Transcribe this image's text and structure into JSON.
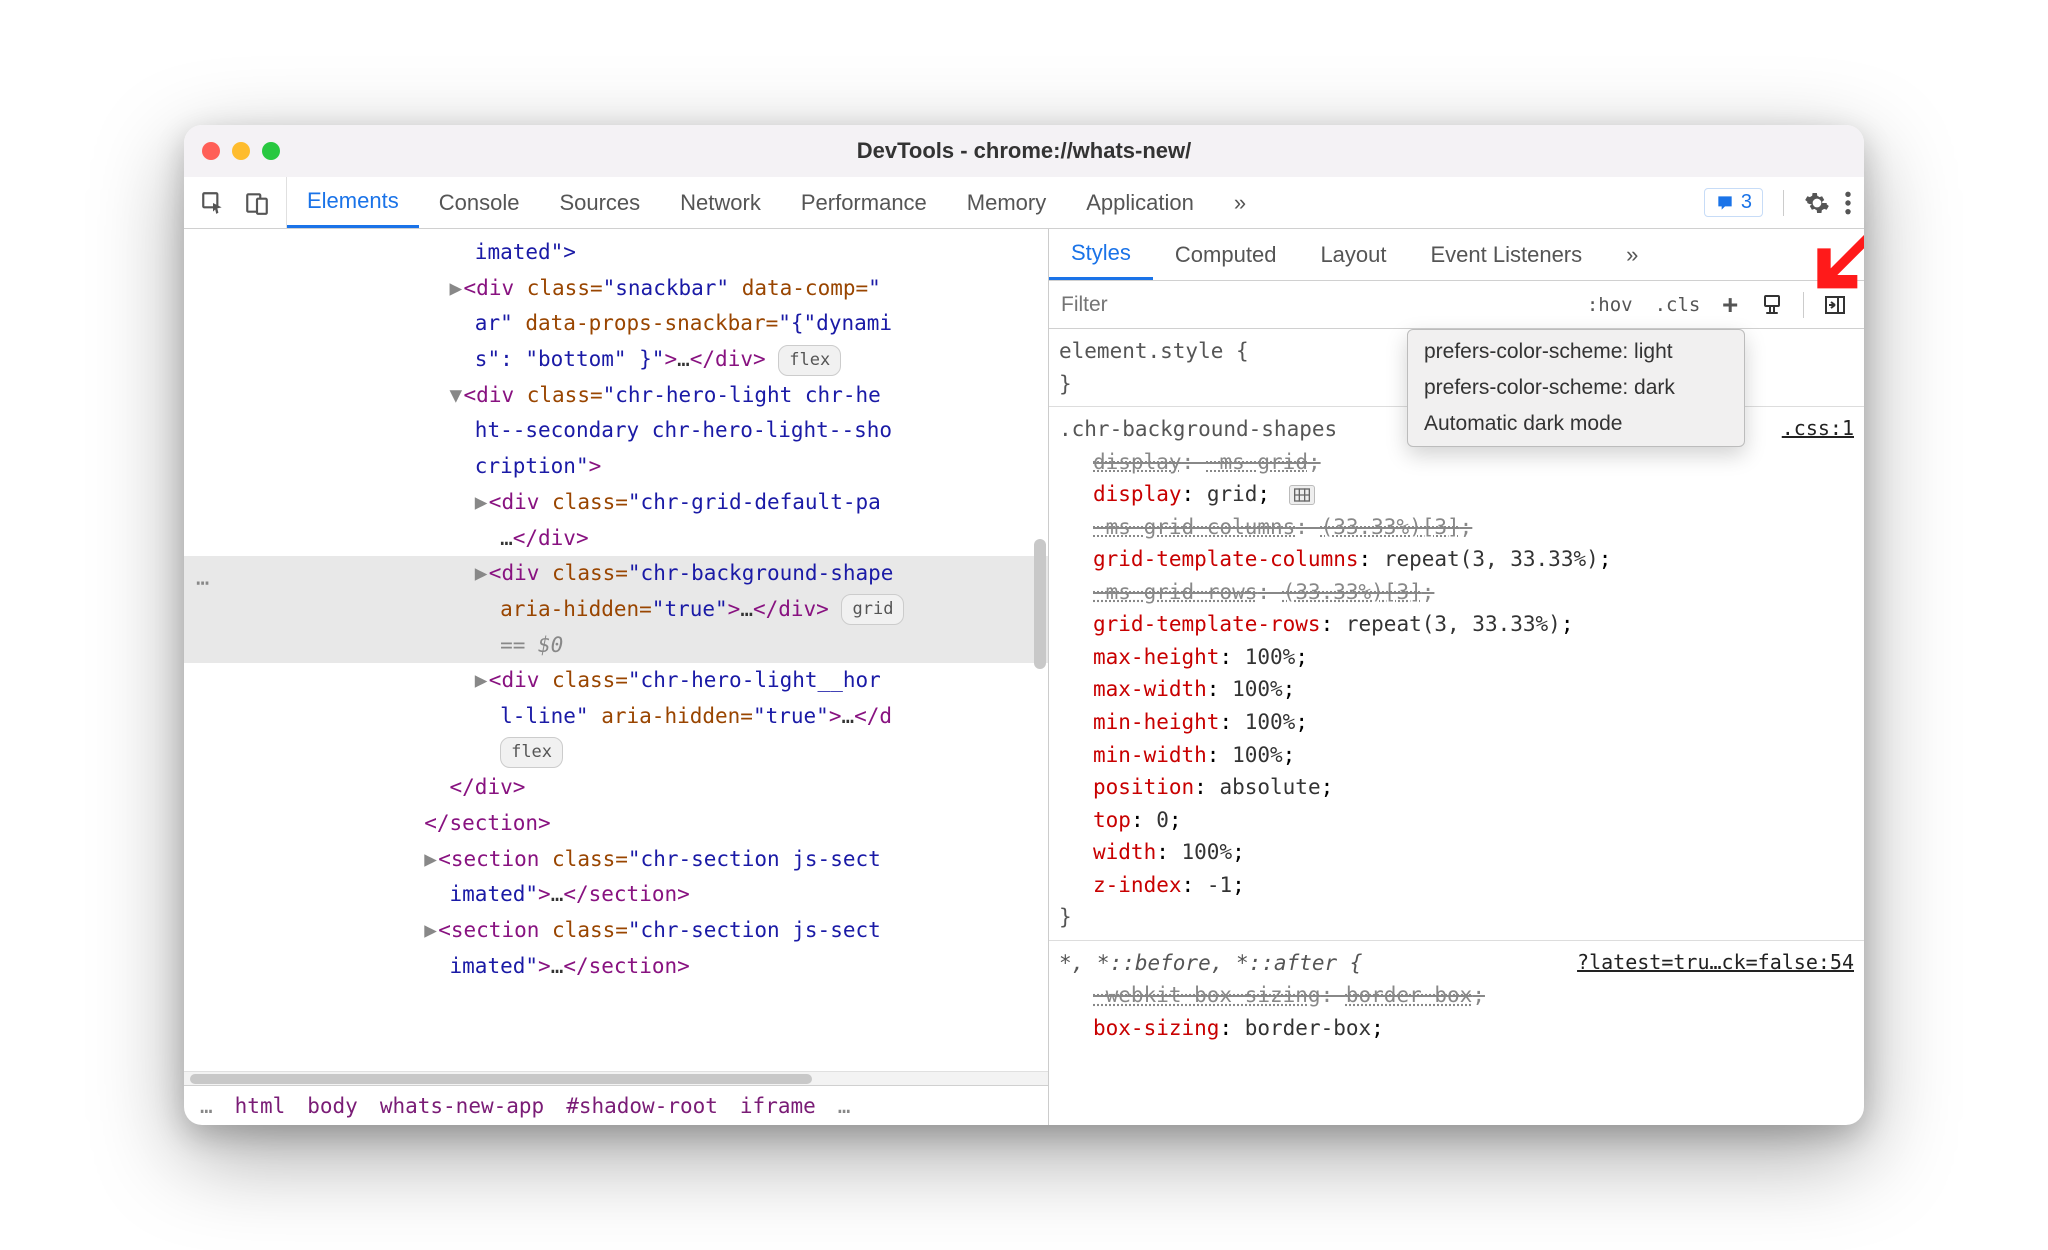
{
  "window": {
    "title": "DevTools - chrome://whats-new/"
  },
  "main_tabs": [
    "Elements",
    "Console",
    "Sources",
    "Network",
    "Performance",
    "Memory",
    "Application"
  ],
  "main_tabs_more": "»",
  "issues_count": "3",
  "style_tabs": [
    "Styles",
    "Computed",
    "Layout",
    "Event Listeners"
  ],
  "style_tabs_more": "»",
  "filter": {
    "placeholder": "Filter",
    "hov": ":hov",
    "cls": ".cls",
    "plus": "+"
  },
  "popup": {
    "items": [
      "prefers-color-scheme: light",
      "prefers-color-scheme: dark",
      "Automatic dark mode"
    ]
  },
  "dom": {
    "l0": "imated\">",
    "l1a": "<div",
    "l1b": " class=",
    "l1c": "\"snackbar\"",
    "l1d": " data-comp=",
    "l1e": "\"",
    "l2a": "ar\"",
    "l2b": " data-props-snackbar=",
    "l2c": "\"{\"dynami",
    "l3a": "s\": \"bottom\" }\"",
    "l3b": ">",
    "l3c": "…",
    "l3d": "</div>",
    "pill_flex": "flex",
    "l4a": "<div",
    "l4b": " class=",
    "l4c": "\"chr-hero-light chr-he",
    "l5": "ht--secondary chr-hero-light--sho",
    "l6a": "cription\"",
    "l6b": ">",
    "l7a": "<div",
    "l7b": " class=",
    "l7c": "\"chr-grid-default-pa",
    "l8a": "…",
    "l8b": "</div>",
    "l9a": "<div",
    "l9b": " class=",
    "l9c": "\"chr-background-shape",
    "l10a": "aria-hidden=",
    "l10b": "\"true\"",
    "l10c": ">",
    "l10d": "…",
    "l10e": "</div>",
    "pill_grid": "grid",
    "l11": "== $0",
    "l12a": "<div",
    "l12b": " class=",
    "l12c": "\"chr-hero-light__hor",
    "l13a": "l-line\"",
    "l13b": " aria-hidden=",
    "l13c": "\"true\"",
    "l13d": ">",
    "l13e": "…",
    "l13f": "</d",
    "l14close": "</div>",
    "l15close": "</section>",
    "l16a": "<section",
    "l16b": " class=",
    "l16c": "\"chr-section js-sect",
    "l17a": "imated\"",
    "l17b": ">",
    "l17c": "…",
    "l17d": "</section>",
    "l18a": "<section",
    "l18b": " class=",
    "l18c": "\"chr-section js-sect",
    "l19a": "imated\"",
    "l19b": ">",
    "l19c": "…",
    "l19d": "</section>"
  },
  "breadcrumbs": [
    "…",
    "html",
    "body",
    "whats-new-app",
    "#shadow-root",
    "iframe",
    "…"
  ],
  "rules": {
    "r0": {
      "selector": "element.style {",
      "close": "}"
    },
    "r1": {
      "selector": ".chr-background-shapes",
      "src": ".css:1",
      "props": [
        {
          "n": "display",
          "v": "-ms-grid",
          "strike": true,
          "underline": true
        },
        {
          "n": "display",
          "v": "grid",
          "grid_icon": true
        },
        {
          "n": "-ms-grid-columns",
          "v": "(33.33%)[3]",
          "strike": true,
          "underline": true
        },
        {
          "n": "grid-template-columns",
          "v": "repeat(3, 33.33%)"
        },
        {
          "n": "-ms-grid-rows",
          "v": "(33.33%)[3]",
          "strike": true,
          "underline": true
        },
        {
          "n": "grid-template-rows",
          "v": "repeat(3, 33.33%)"
        },
        {
          "n": "max-height",
          "v": "100%"
        },
        {
          "n": "max-width",
          "v": "100%"
        },
        {
          "n": "min-height",
          "v": "100%"
        },
        {
          "n": "min-width",
          "v": "100%"
        },
        {
          "n": "position",
          "v": "absolute"
        },
        {
          "n": "top",
          "v": "0"
        },
        {
          "n": "width",
          "v": "100%"
        },
        {
          "n": "z-index",
          "v": "-1"
        }
      ],
      "close": "}"
    },
    "r2": {
      "selector": "*, *::before, *::after {",
      "src": "?latest=tru…ck=false:54",
      "props": [
        {
          "n": "-webkit-box-sizing",
          "v": "border-box",
          "strike": true,
          "underline": true
        },
        {
          "n": "box-sizing",
          "v": "border-box"
        }
      ]
    }
  }
}
